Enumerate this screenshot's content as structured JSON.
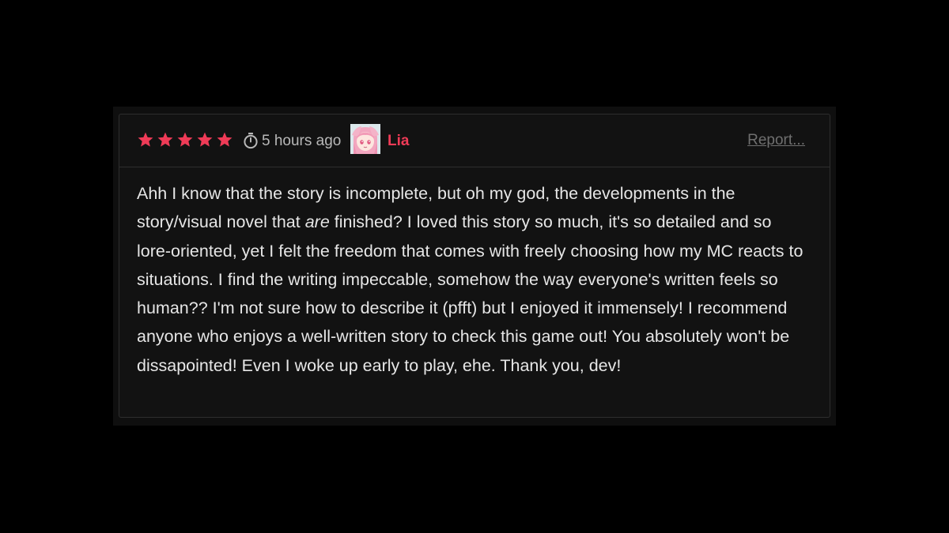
{
  "review": {
    "rating": 5,
    "rating_max": 5,
    "star_color": "#ef3b57",
    "time_icon": "timer-icon",
    "time_ago": "5 hours ago",
    "author": {
      "name": "Lia",
      "name_color": "#ef3b57"
    },
    "report_label": "Report...",
    "body": {
      "part1": "Ahh I know that the story is incomplete, but oh my god, the developments in the story/visual novel that ",
      "emphasis": "are",
      "part2": " finished? I loved this story so much, it's so detailed and so lore-oriented, yet I felt the freedom that comes with freely choosing how my MC reacts to situations. I find the writing impeccable, somehow the way everyone's written feels so human?? I'm not sure how to describe it (pfft) but I enjoyed it immensely! I recommend anyone who enjoys a well-written story to check this game out! You absolutely won't be dissapointed! Even I woke up early to play, ehe. Thank you, dev!"
    }
  }
}
